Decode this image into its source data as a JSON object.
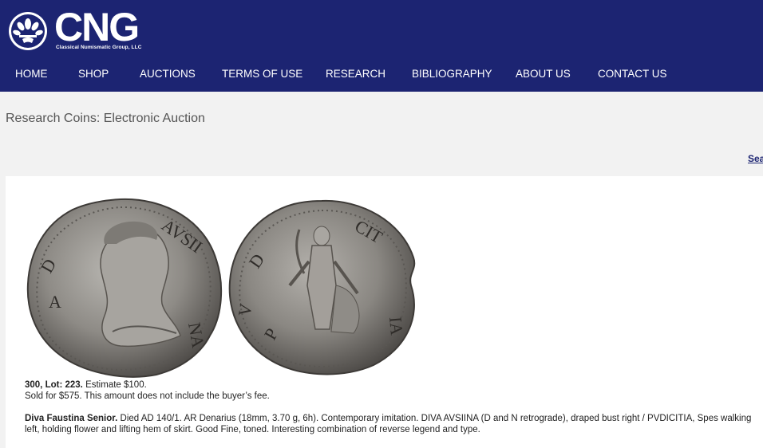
{
  "brand": {
    "name": "CNG",
    "subtitle": "Classical Numismatic Group, LLC"
  },
  "nav": {
    "items": [
      {
        "label": "HOME"
      },
      {
        "label": "SHOP"
      },
      {
        "label": "AUCTIONS"
      },
      {
        "label": "TERMS OF USE"
      },
      {
        "label": "RESEARCH"
      },
      {
        "label": "BIBLIOGRAPHY"
      },
      {
        "label": "ABOUT US"
      },
      {
        "label": "CONTACT US"
      }
    ]
  },
  "page": {
    "title": "Research Coins: Electronic Auction",
    "search_link": "Sea"
  },
  "lot": {
    "sale_lot": "300, Lot: 223.",
    "estimate": " Estimate $100.",
    "sold": "Sold for $575. This amount does not include the buyer’s fee.",
    "name": "Diva Faustina Senior.",
    "description": " Died AD 140/1. AR Denarius (18mm, 3.70 g, 6h). Contemporary imitation. DIVA AVSIINA (D and N retrograde), draped bust right / PVDICITIA, Spes walking left, holding flower and lifting hem of skirt. Good Fine, toned. Interesting combination of reverse legend and type."
  },
  "colors": {
    "header_bg": "#1c2472",
    "page_bg": "#f2f2f2",
    "card_bg": "#ffffff"
  }
}
